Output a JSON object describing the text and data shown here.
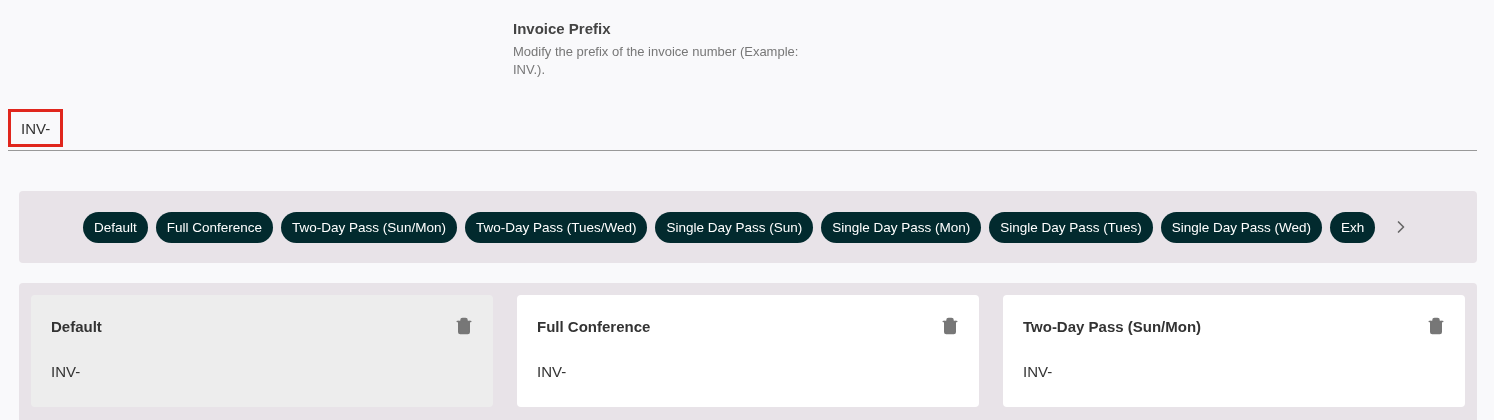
{
  "setting": {
    "title": "Invoice Prefix",
    "description": "Modify the prefix of the invoice number (Example: INV.)."
  },
  "prefix_field": {
    "value": "INV-",
    "highlighted": true
  },
  "chips": [
    {
      "label": "Default"
    },
    {
      "label": "Full Conference"
    },
    {
      "label": "Two-Day Pass (Sun/Mon)"
    },
    {
      "label": "Two-Day Pass (Tues/Wed)"
    },
    {
      "label": "Single Day Pass (Sun)"
    },
    {
      "label": "Single Day Pass (Mon)"
    },
    {
      "label": "Single Day Pass (Tues)"
    },
    {
      "label": "Single Day Pass (Wed)"
    },
    {
      "label": "Exh"
    }
  ],
  "cards": [
    {
      "title": "Default",
      "value": "INV-",
      "selected": true
    },
    {
      "title": "Full Conference",
      "value": "INV-",
      "selected": false
    },
    {
      "title": "Two-Day Pass (Sun/Mon)",
      "value": "INV-",
      "selected": false
    }
  ]
}
